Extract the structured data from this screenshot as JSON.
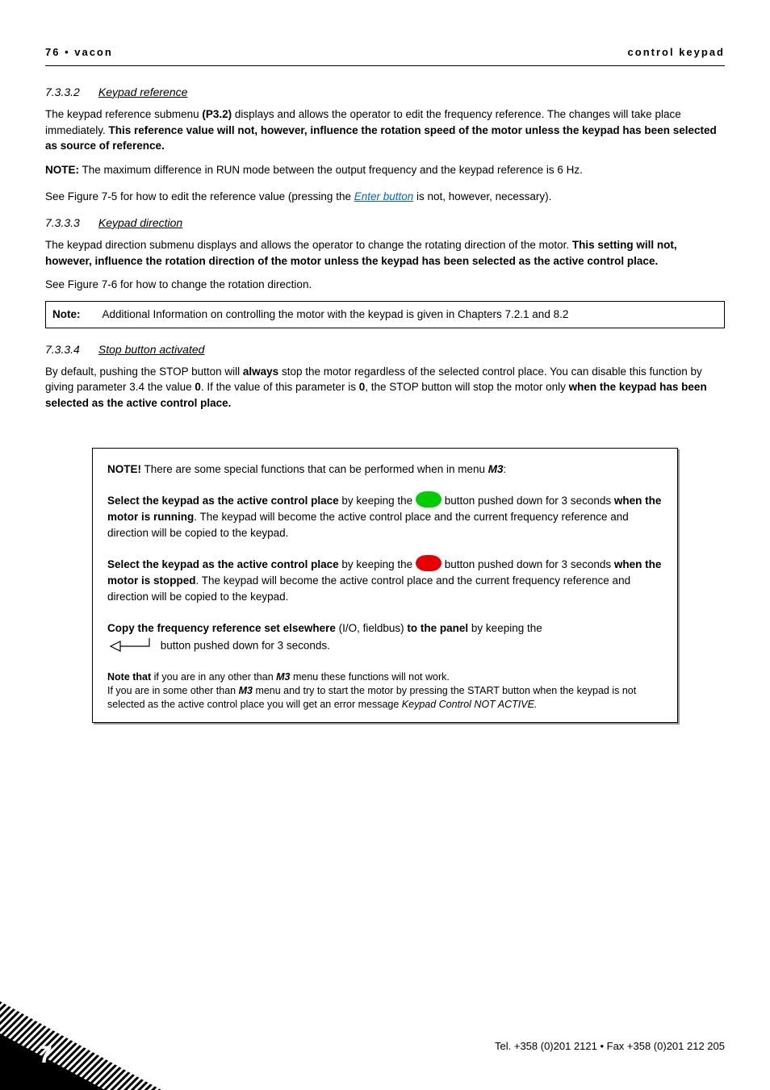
{
  "header": {
    "left": "76 • vacon",
    "right": "control keypad"
  },
  "s1": {
    "num": "7.3.3.2",
    "title": "Keypad reference",
    "p1a": "The keypad reference submenu ",
    "p1b": "(P3.2)",
    "p1c": " displays and allows the operator to edit the frequency reference. The changes will take place immediately. ",
    "p1d": "This reference value will not, however, influence the rotation speed of the motor unless the keypad has been selected as source of reference.",
    "noteLbl": "NOTE:",
    "noteTxt": " The maximum difference in RUN mode between the output frequency and the keypad reference is 6 Hz.",
    "p2a": "See Figure 7-5 for how to edit the reference value (pressing the ",
    "p2link": "Enter button",
    "p2b": " is not, however, necessary)."
  },
  "s2": {
    "num": "7.3.3.3",
    "title": "Keypad direction",
    "p1a": "The keypad direction submenu displays and allows the operator to change the rotating direction of the motor. ",
    "p1b": "This setting will not, however, influence the rotation direction of the motor unless the keypad has been selected as the active control place.",
    "p2": "See Figure 7-6 for how to change the rotation direction.",
    "noteLabel": "Note:",
    "noteText": "Additional Information on controlling the motor with the keypad is given in Chapters 7.2.1 and 8.2"
  },
  "s3": {
    "num": "7.3.3.4",
    "title": "Stop button activated",
    "p1a": "By default, pushing the STOP button will ",
    "p1b": "always",
    "p1c": " stop the motor regardless of the selected control place. You can disable this function by giving parameter 3.4 the value ",
    "p1d": "0",
    "p1e": ". If the value of this parameter is ",
    "p1f": "0",
    "p1g": ", the STOP button will stop the motor only ",
    "p1h": "when the keypad has been selected as the active control place."
  },
  "box": {
    "l1a": "NOTE!",
    "l1b": " There are some special functions that can be performed when in menu ",
    "l1c": "M3",
    "l1d": ":",
    "l2a": "Select the keypad as the active control place",
    "l2b": " by keeping the ",
    "l2c": " button pushed down for 3 seconds ",
    "l2d": "when the motor is running",
    "l2e": ". The keypad will become the active control place and the current frequency reference and direction will be copied to the keypad.",
    "l3a": "Select the keypad as the active control place",
    "l3b": " by keeping the ",
    "l3c": " button pushed down for 3 seconds ",
    "l3d": "when the motor is stopped",
    "l3e": ". The keypad will become the active control place and the current frequency reference and direction will be copied to the keypad.",
    "l4a": "Copy the frequency reference set elsewhere",
    "l4b": " (I/O, fieldbus) ",
    "l4c": "to the panel",
    "l4d": " by keeping the ",
    "l4e": " button pushed down for 3 seconds.",
    "l5a": "Note that",
    "l5b": " if you are in any other than ",
    "l5c": "M3",
    "l5d": " menu these functions will not work.",
    "l6a": "If you are in some other than ",
    "l6b": "M3",
    "l6c": " menu and try to start the motor by pressing the START button when the keypad is not selected as the active control place you will get an error message ",
    "l6d": "Keypad Control NOT ACTIVE."
  },
  "footer": {
    "contact": "Tel. +358 (0)201 2121 • Fax +358 (0)201 212 205",
    "chapter": "7"
  }
}
